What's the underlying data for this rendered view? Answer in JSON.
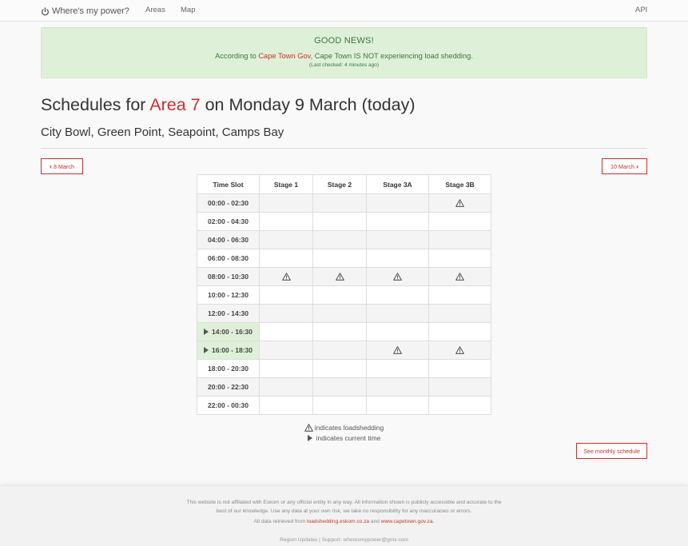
{
  "nav": {
    "brand": "Where's my power?",
    "brand_icon": "power-icon",
    "areas": "Areas",
    "map": "Map",
    "api": "API"
  },
  "alert": {
    "title": "GOOD NEWS!",
    "prefix": "According to ",
    "link": "Cape Town Gov",
    "suffix": ", Cape Town IS NOT experiencing load shedding.",
    "checked": "(Last checked: 4 minutes ago)"
  },
  "heading": {
    "prefix": "Schedules for ",
    "area": "Area 7",
    "suffix": " on Monday 9 March (today)",
    "subtitle": "City Bowl, Green Point, Seapoint, Camps Bay"
  },
  "buttons": {
    "prev": "8 March",
    "next": "10 March",
    "monthly": "See monthly schedule"
  },
  "schedule": {
    "headers": [
      "Time Slot",
      "Stage 1",
      "Stage 2",
      "Stage 3A",
      "Stage 3B"
    ],
    "rows": [
      {
        "slot": "00:00 - 02:30",
        "current": false,
        "shed": [
          false,
          false,
          false,
          true
        ]
      },
      {
        "slot": "02:00 - 04:30",
        "current": false,
        "shed": [
          false,
          false,
          false,
          false
        ]
      },
      {
        "slot": "04:00 - 06:30",
        "current": false,
        "shed": [
          false,
          false,
          false,
          false
        ]
      },
      {
        "slot": "06:00 - 08:30",
        "current": false,
        "shed": [
          false,
          false,
          false,
          false
        ]
      },
      {
        "slot": "08:00 - 10:30",
        "current": false,
        "shed": [
          true,
          true,
          true,
          true
        ]
      },
      {
        "slot": "10:00 - 12:30",
        "current": false,
        "shed": [
          false,
          false,
          false,
          false
        ]
      },
      {
        "slot": "12:00 - 14:30",
        "current": false,
        "shed": [
          false,
          false,
          false,
          false
        ]
      },
      {
        "slot": "14:00 - 16:30",
        "current": true,
        "shed": [
          false,
          false,
          false,
          false
        ]
      },
      {
        "slot": "16:00 - 18:30",
        "current": true,
        "shed": [
          false,
          false,
          true,
          true
        ]
      },
      {
        "slot": "18:00 - 20:30",
        "current": false,
        "shed": [
          false,
          false,
          false,
          false
        ]
      },
      {
        "slot": "20:00 - 22:30",
        "current": false,
        "shed": [
          false,
          false,
          false,
          false
        ]
      },
      {
        "slot": "22:00 - 00:30",
        "current": false,
        "shed": [
          false,
          false,
          false,
          false
        ]
      }
    ]
  },
  "legend": {
    "loadshedding": "indicates loadshedding",
    "current": "indicates current time"
  },
  "footer": {
    "line1": "This website is not affiliated with Eskom or any official entity in any way. All information shown is publicly accessible and accurate to the",
    "line2": "best of our knowledge. Use any data at your own risk, we take no responsibility for any inaccuracies or errors.",
    "line3_prefix": "All data retrieved from ",
    "link1": "loadshedding.eskom.co.za",
    "line3_mid": " and ",
    "link2": "www.capetown.gov.za",
    "line3_suffix": ".",
    "line4": "Region Updates | Support: wheresmypower@gmx.com"
  },
  "colors": {
    "accent": "#c9302c",
    "alert_bg": "#dff0d8",
    "alert_text": "#3c763d",
    "current_slot_bg": "#dff0d8"
  }
}
